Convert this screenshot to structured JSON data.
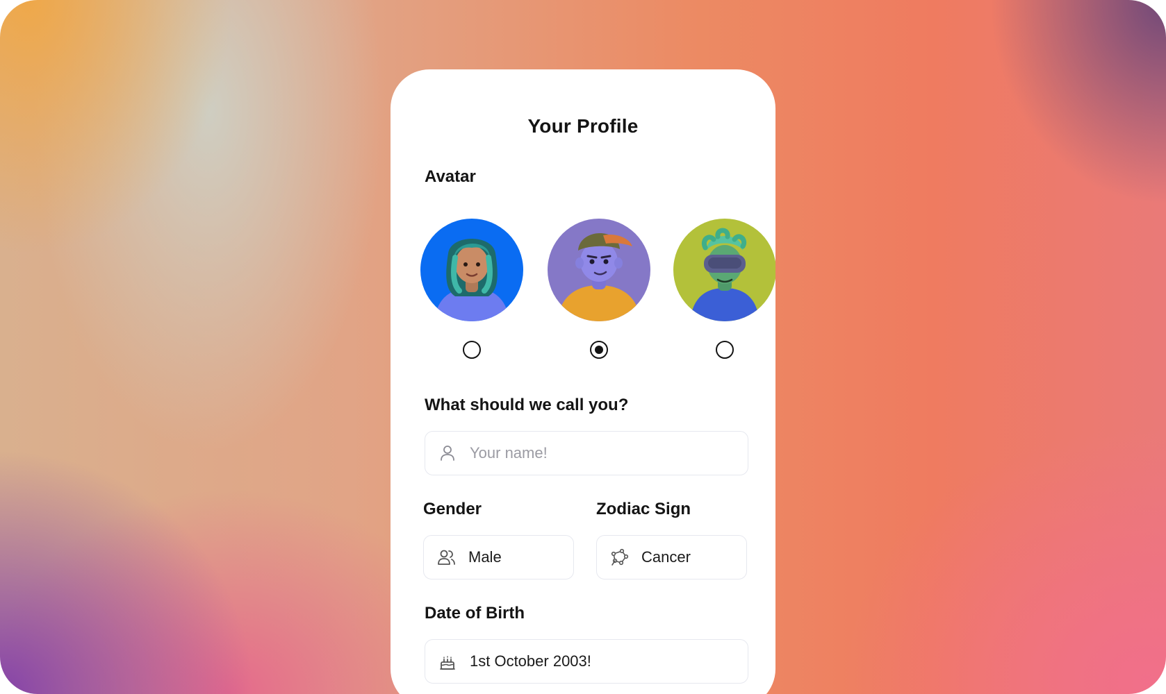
{
  "profile": {
    "title": "Your Profile",
    "avatar_label": "Avatar",
    "avatars": [
      {
        "name": "avatar-teal-hair",
        "bg": "#0a6cf2",
        "selected": false
      },
      {
        "name": "avatar-cap",
        "bg": "#8578c7",
        "selected": true
      },
      {
        "name": "avatar-vr-headset",
        "bg": "#b3c13a",
        "selected": false
      }
    ],
    "name_label": "What should we call you?",
    "name_placeholder": "Your name!",
    "gender_label": "Gender",
    "gender_value": "Male",
    "zodiac_label": "Zodiac Sign",
    "zodiac_value": "Cancer",
    "dob_label": "Date of Birth",
    "dob_value": "1st October 2003!"
  },
  "icons": {
    "name_field": "user-icon",
    "gender_field": "users-icon",
    "zodiac_field": "zodiac-cancer-icon",
    "dob_field": "cake-icon"
  },
  "colors": {
    "text": "#141414",
    "placeholder": "#9b9ba3",
    "field_border": "#e6e8ef"
  }
}
